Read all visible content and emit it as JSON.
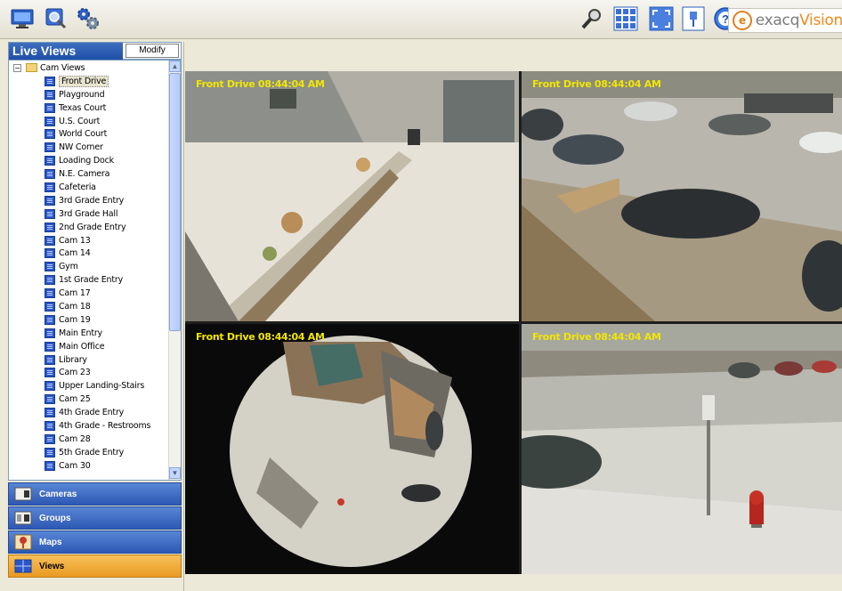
{
  "toolbar": {
    "left_icons": [
      "monitor-icon",
      "search-magnifier-icon",
      "gears-icon"
    ],
    "right_icons": [
      "key-search-icon",
      "grid-layout-icon",
      "fullscreen-icon",
      "pin-icon",
      "help-icon"
    ],
    "logo_text_a": "exacq",
    "logo_text_b": "Vision"
  },
  "left_panel": {
    "title": "Live Views",
    "modify_label": "Modify",
    "root_label": "Cam Views",
    "items": [
      "Front Drive",
      "Playground",
      "Texas Court",
      "U.S. Court",
      "World Court",
      "NW Corner",
      "Loading Dock",
      "N.E. Camera",
      "Cafeteria",
      "3rd Grade Entry",
      "3rd Grade Hall",
      "2nd Grade Entry",
      "Cam 13",
      "Cam 14",
      "Gym",
      "1st Grade Entry",
      "Cam 17",
      "Cam 18",
      "Cam 19",
      "Main Entry",
      "Main Office",
      "Library",
      "Cam 23",
      "Upper Landing-Stairs",
      "Cam 25",
      "4th Grade Entry",
      "4th Grade - Restrooms",
      "Cam 28",
      "5th Grade Entry",
      "Cam 30"
    ],
    "selected_index": 0
  },
  "nav": {
    "items": [
      {
        "label": "Cameras",
        "icon": "camera-icon",
        "active": false
      },
      {
        "label": "Groups",
        "icon": "groups-icon",
        "active": false
      },
      {
        "label": "Maps",
        "icon": "map-icon",
        "active": false
      },
      {
        "label": "Views",
        "icon": "views-grid-icon",
        "active": true
      }
    ]
  },
  "video": {
    "cells": [
      {
        "timestamp": "Front Drive 08:44:04 AM"
      },
      {
        "timestamp": "Front Drive 08:44:04 AM"
      },
      {
        "timestamp": "Front Drive 08:44:04 AM"
      },
      {
        "timestamp": "Front Drive 08:44:04 AM"
      }
    ]
  },
  "colors": {
    "accent_blue": "#2c58b4",
    "active_orange": "#e89a22",
    "timestamp_yellow": "#f2e600"
  }
}
